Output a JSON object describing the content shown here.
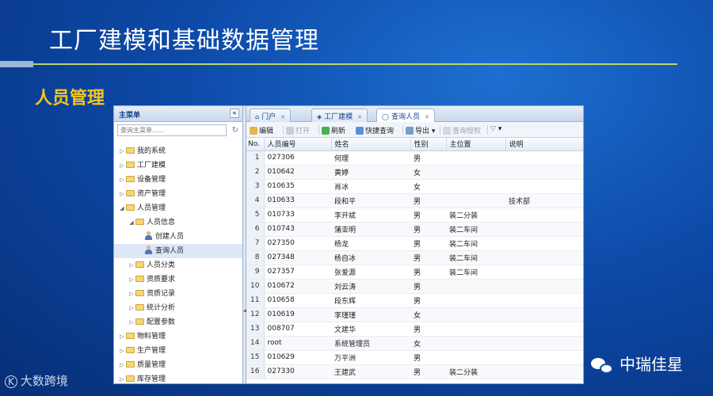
{
  "slide": {
    "title": "工厂建模和基础数据管理",
    "section": "人员管理"
  },
  "sidebar": {
    "header": "主菜单",
    "collapse_glyph": "«",
    "search_placeholder": "查询主菜单......",
    "items": [
      {
        "label": "我的系统",
        "level": 0,
        "expanded": false,
        "icon": "folder-icon"
      },
      {
        "label": "工厂建模",
        "level": 0,
        "expanded": false,
        "icon": "folder-icon"
      },
      {
        "label": "设备管理",
        "level": 0,
        "expanded": false,
        "icon": "folder-icon"
      },
      {
        "label": "资产管理",
        "level": 0,
        "expanded": false,
        "icon": "folder-icon"
      },
      {
        "label": "人员管理",
        "level": 0,
        "expanded": true,
        "icon": "folder-icon"
      },
      {
        "label": "人员信息",
        "level": 1,
        "expanded": true,
        "icon": "folder-icon"
      },
      {
        "label": "创建人员",
        "level": 2,
        "icon": "person-icon"
      },
      {
        "label": "查询人员",
        "level": 2,
        "icon": "person-icon",
        "selected": true
      },
      {
        "label": "人员分类",
        "level": 1,
        "expanded": false,
        "icon": "folder-icon"
      },
      {
        "label": "资质要求",
        "level": 1,
        "expanded": false,
        "icon": "folder-icon"
      },
      {
        "label": "资质记录",
        "level": 1,
        "expanded": false,
        "icon": "folder-icon"
      },
      {
        "label": "统计分析",
        "level": 1,
        "expanded": false,
        "icon": "folder-icon"
      },
      {
        "label": "配置参数",
        "level": 1,
        "expanded": false,
        "icon": "folder-icon"
      },
      {
        "label": "物料管理",
        "level": 0,
        "expanded": false,
        "icon": "folder-icon"
      },
      {
        "label": "生产管理",
        "level": 0,
        "expanded": false,
        "icon": "folder-icon"
      },
      {
        "label": "质量管理",
        "level": 0,
        "expanded": false,
        "icon": "folder-icon"
      },
      {
        "label": "库存管理",
        "level": 0,
        "expanded": false,
        "icon": "folder-icon"
      }
    ]
  },
  "tabs": [
    {
      "label": "门户",
      "icon": "home-icon",
      "active": false
    },
    {
      "label": "工厂建模",
      "icon": "model-icon",
      "active": false
    },
    {
      "label": "查询人员",
      "icon": "search-person-icon",
      "active": true
    }
  ],
  "toolbar": {
    "edit": "编辑",
    "open": "打开",
    "refresh": "刷新",
    "quick_query": "快捷查询",
    "export": "导出",
    "query_auth": "查询授权"
  },
  "grid": {
    "columns": [
      "No.",
      "人员编号",
      "姓名",
      "性别",
      "主位置",
      "说明"
    ],
    "rows": [
      [
        "1",
        "027306",
        "何理",
        "男",
        "",
        ""
      ],
      [
        "2",
        "010642",
        "黄婷",
        "女",
        "",
        ""
      ],
      [
        "3",
        "010635",
        "肖冰",
        "女",
        "",
        ""
      ],
      [
        "4",
        "010633",
        "段和平",
        "男",
        "",
        "技术部"
      ],
      [
        "5",
        "010733",
        "李开斌",
        "男",
        "装二分装",
        ""
      ],
      [
        "6",
        "010743",
        "蒲亚明",
        "男",
        "装二车间",
        ""
      ],
      [
        "7",
        "027350",
        "杨龙",
        "男",
        "装二车间",
        ""
      ],
      [
        "8",
        "027348",
        "杨自冰",
        "男",
        "装二车间",
        ""
      ],
      [
        "9",
        "027357",
        "张爱源",
        "男",
        "装二车间",
        ""
      ],
      [
        "10",
        "010672",
        "刘云涛",
        "男",
        "",
        ""
      ],
      [
        "11",
        "010658",
        "段东辉",
        "男",
        "",
        ""
      ],
      [
        "12",
        "010619",
        "李瑾瑾",
        "女",
        "",
        ""
      ],
      [
        "13",
        "008707",
        "文建华",
        "男",
        "",
        ""
      ],
      [
        "14",
        "root",
        "系统管理员",
        "女",
        "",
        ""
      ],
      [
        "15",
        "010629",
        "万平洲",
        "男",
        "",
        ""
      ],
      [
        "16",
        "027330",
        "王建武",
        "男",
        "装二分装",
        ""
      ]
    ]
  },
  "watermarks": {
    "left": "大数跨境",
    "left_logo": "K",
    "right": "中瑞佳星"
  },
  "colors": {
    "background": "#0d4aa8",
    "title_rule": "#b9d66b",
    "section_title": "#f6c61a",
    "header_text": "#15428b"
  }
}
